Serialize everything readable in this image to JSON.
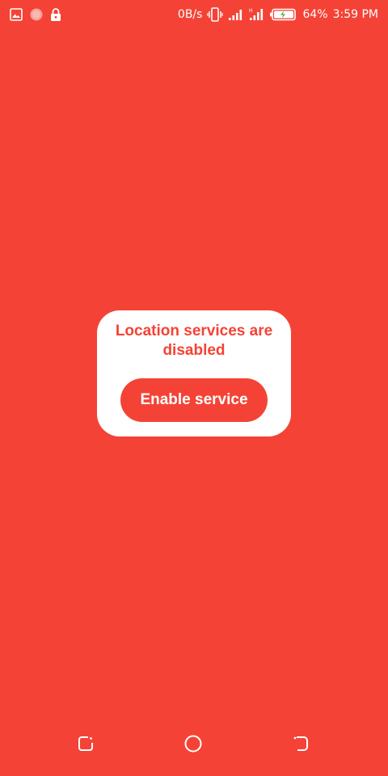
{
  "status_bar": {
    "left_icons": [
      "image-icon",
      "circle-status-icon",
      "lock-icon"
    ],
    "net_speed": "0B/s",
    "battery_percent": "64%",
    "time": "3:59 PM",
    "icons": [
      "vibrate-icon",
      "signal-icon",
      "hd-signal-icon",
      "battery-charging-icon"
    ]
  },
  "dialog": {
    "title": "Location services are disabled",
    "button_label": "Enable service"
  },
  "nav_bar": {
    "icons": [
      "recent-apps-icon",
      "home-icon",
      "back-icon"
    ]
  },
  "colors": {
    "background": "#f44336",
    "dialog_bg": "#ffffff",
    "accent": "#f44336",
    "battery_bolt": "#4caf50"
  }
}
